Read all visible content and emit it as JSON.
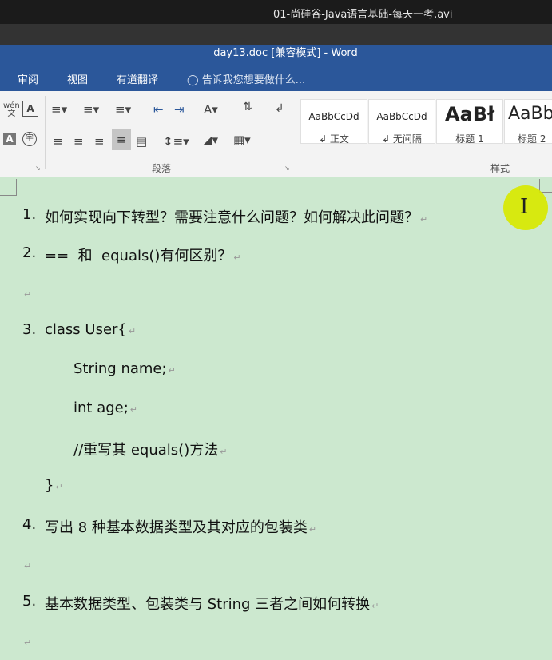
{
  "video": {
    "title": "01-尚硅谷-Java语言基础-每天一考.avi"
  },
  "window": {
    "title": "day13.doc [兼容模式] - Word"
  },
  "tabs": [
    {
      "label": "审阅"
    },
    {
      "label": "视图"
    },
    {
      "label": "有道翻译"
    }
  ],
  "tell_me": {
    "placeholder": "告诉我您想要做什么..."
  },
  "ribbon": {
    "phonetic_guide": "wén\n文",
    "paragraph_group_label": "段落",
    "styles_group_label": "样式",
    "styles": [
      {
        "preview": "AaBbCcDd",
        "name": "↲ 正文"
      },
      {
        "preview": "AaBbCcDd",
        "name": "↲ 无间隔"
      },
      {
        "preview": "AaBł",
        "name": "标题 1"
      },
      {
        "preview": "AaBb",
        "name": "标题 2"
      }
    ]
  },
  "document": {
    "paragraph_mark": "↵",
    "lines": [
      {
        "num": "1.",
        "text": "如何实现向下转型？需要注意什么问题？如何解决此问题？"
      },
      {
        "num": "2.",
        "text": "==  和  equals()有何区别？"
      },
      {
        "num": "",
        "text": ""
      },
      {
        "num": "3.",
        "text": "class User{"
      },
      {
        "num": "",
        "text": "String name;"
      },
      {
        "num": "",
        "text": "int age;"
      },
      {
        "num": "",
        "text": "//重写其 equals()方法"
      },
      {
        "num": "",
        "text": "}"
      },
      {
        "num": "4.",
        "text": "写出 8 种基本数据类型及其对应的包装类"
      },
      {
        "num": "",
        "text": ""
      },
      {
        "num": "5.",
        "text": "基本数据类型、包装类与 String 三者之间如何转换"
      },
      {
        "num": "",
        "text": ""
      }
    ]
  }
}
